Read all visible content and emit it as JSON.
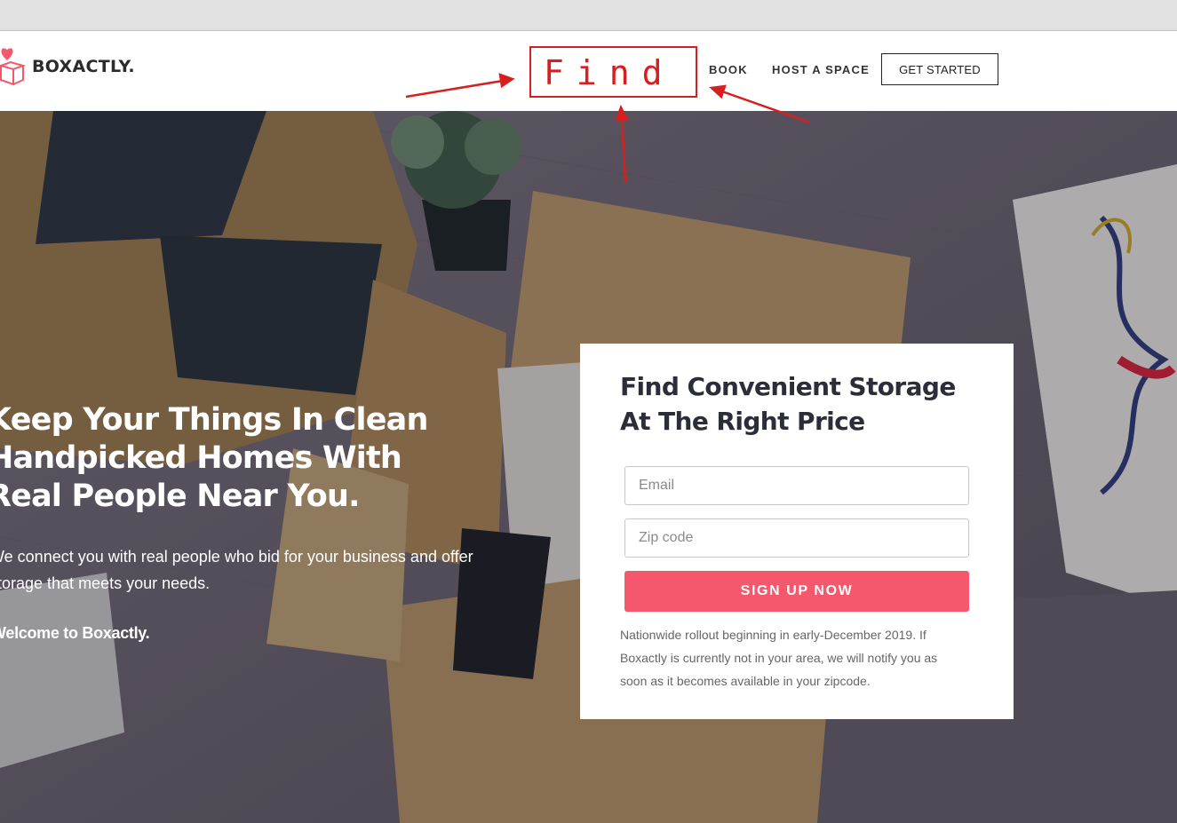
{
  "brand": {
    "name": "BOXACTLY.",
    "accent": "#f5576c"
  },
  "nav": {
    "items": [
      {
        "label": "BOOK"
      },
      {
        "label": "HOST A SPACE"
      }
    ],
    "cta_label": "GET STARTED"
  },
  "annotation": {
    "text": "Find",
    "color": "#d61f1f"
  },
  "hero": {
    "heading": "Keep Your Things In Clean Handpicked Homes With Real People Near You.",
    "subtext": "We connect you with real people who bid for your business and offer storage that meets your needs.",
    "welcome": "Welcome to Boxactly."
  },
  "signup": {
    "title": "Find Convenient Storage At The Right Price",
    "email_placeholder": "Email",
    "zip_placeholder": "Zip code",
    "button_label": "SIGN UP NOW",
    "note": "Nationwide rollout beginning in early-December 2019. If Boxactly is currently not in your area, we will notify you as soon as it becomes available in your zipcode."
  }
}
